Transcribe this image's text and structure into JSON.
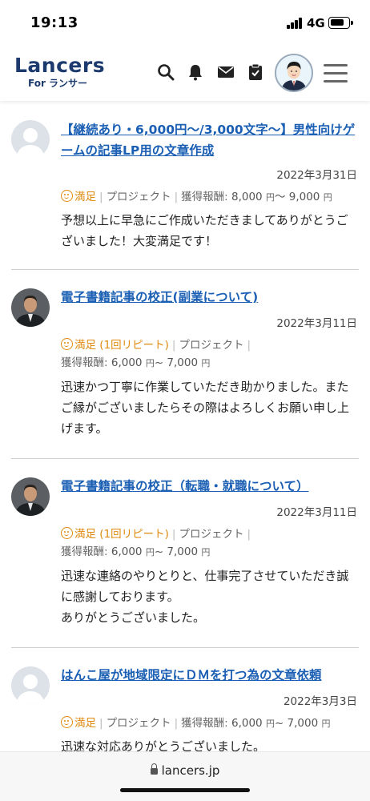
{
  "status_bar": {
    "time": "19:13",
    "network": "4G",
    "battery_level": 0.7
  },
  "header": {
    "logo_main": "Lancers",
    "logo_sub": "For ランサー",
    "icons": [
      "search-icon",
      "bell-icon",
      "mail-icon",
      "clipboard-check-icon",
      "user-avatar",
      "hamburger-menu-icon"
    ]
  },
  "reviews": [
    {
      "title": "【継続あり・6,000円〜/3,000文字〜】男性向けゲームの記事LP用の文章作成",
      "date": "2022年3月31日",
      "rating": "満足",
      "repeat": "",
      "type": "プロジェクト",
      "fee_label": "獲得報酬:",
      "fee_min": "8,000",
      "fee_max": "9,000",
      "unit": "円",
      "body": "予想以上に早急にご作成いただきましてありがとうございました！大変満足です！",
      "avatar": "default"
    },
    {
      "title": "電子書籍記事の校正(副業について)",
      "date": "2022年3月11日",
      "rating": "満足",
      "repeat": "(1回リピート)",
      "type": "プロジェクト",
      "fee_label": "獲得報酬:",
      "fee_min": "6,000",
      "fee_max": "7,000",
      "unit": "円",
      "body": "迅速かつ丁寧に作業していただき助かりました。またご縁がございましたらその際はよろしくお願い申し上げます。",
      "avatar": "photo"
    },
    {
      "title": "電子書籍記事の校正（転職・就職について）",
      "date": "2022年3月11日",
      "rating": "満足",
      "repeat": "(1回リピート)",
      "type": "プロジェクト",
      "fee_label": "獲得報酬:",
      "fee_min": "6,000",
      "fee_max": "7,000",
      "unit": "円",
      "body_lines": [
        "迅速な連絡のやりとりと、仕事完了させていただき誠に感謝しております。",
        "ありがとうございました。"
      ],
      "avatar": "photo"
    },
    {
      "title": "はんこ屋が地域限定にＤＭを打つ為の文章依頼",
      "date": "2022年3月3日",
      "rating": "満足",
      "repeat": "",
      "type": "プロジェクト",
      "fee_label": "獲得報酬:",
      "fee_min": "6,000",
      "fee_max": "7,000",
      "unit": "円",
      "body": "迅速な対応ありがとうございました。",
      "avatar": "default"
    }
  ],
  "footer": {
    "url": "lancers.jp"
  },
  "colors": {
    "brand": "#1d3a6e",
    "link": "#1a5fb4",
    "satisfied": "#e08a10"
  }
}
